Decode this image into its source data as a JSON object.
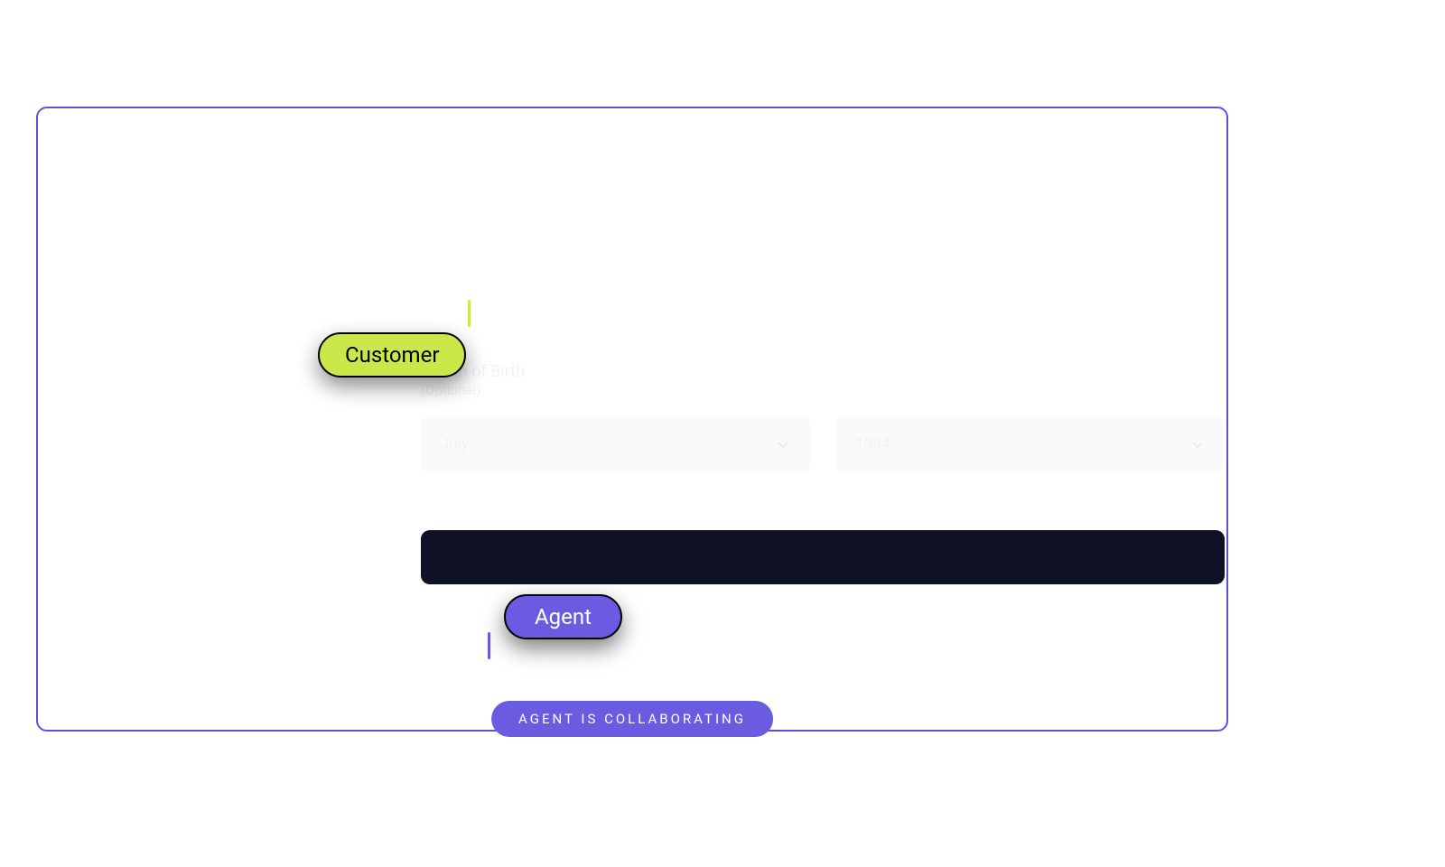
{
  "form": {
    "label": "Month of Birth",
    "sublabel": "(Optional)",
    "month": "July",
    "year": "1984"
  },
  "cursors": {
    "customer": "Customer",
    "agent": "Agent"
  },
  "status": "AGENT IS COLLABORATING"
}
